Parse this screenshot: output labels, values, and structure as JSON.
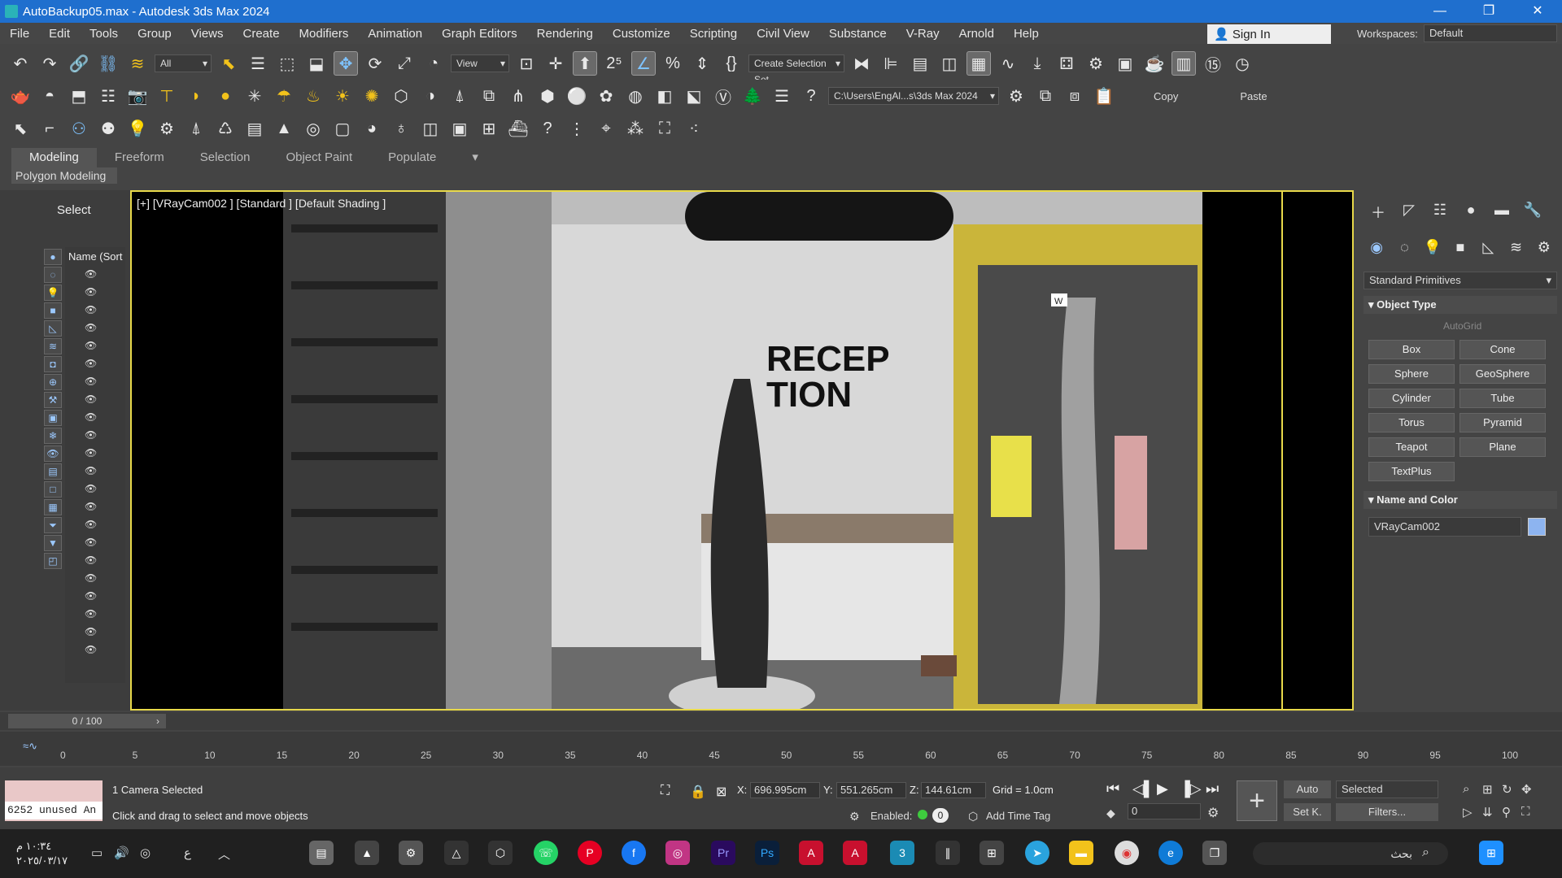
{
  "window": {
    "title": "AutoBackup05.max - Autodesk 3ds Max 2024"
  },
  "menu": [
    "File",
    "Edit",
    "Tools",
    "Group",
    "Views",
    "Create",
    "Modifiers",
    "Animation",
    "Graph Editors",
    "Rendering",
    "Customize",
    "Scripting",
    "Civil View",
    "Substance",
    "V-Ray",
    "Arnold",
    "Help"
  ],
  "signin": "Sign In",
  "workspaces": {
    "label": "Workspaces:",
    "value": "Default"
  },
  "toolbar": {
    "filter": "All",
    "view": "View",
    "selection_set": "Create Selection Set",
    "path": "C:\\Users\\EngAl...s\\3ds Max 2024",
    "copy": "Copy",
    "paste": "Paste"
  },
  "ribbon": {
    "tabs": [
      "Modeling",
      "Freeform",
      "Selection",
      "Object Paint",
      "Populate"
    ],
    "sub": "Polygon Modeling"
  },
  "scene_explorer": {
    "select_label": "Select",
    "column": "Name (Sort"
  },
  "viewport": {
    "label": "[+] [VRayCam002 ] [Standard ] [Default Shading ]",
    "sign_text_1": "RECEP",
    "sign_text_2": "TION",
    "marker": "W"
  },
  "command_panel": {
    "dropdown": "Standard Primitives",
    "object_type": "Object Type",
    "autogrid": "AutoGrid",
    "buttons": [
      "Box",
      "Cone",
      "Sphere",
      "GeoSphere",
      "Cylinder",
      "Tube",
      "Torus",
      "Pyramid",
      "Teapot",
      "Plane",
      "TextPlus"
    ],
    "name_and_color": "Name and Color",
    "object_name": "VRayCam002",
    "object_color": "#8db4f0"
  },
  "timeline": {
    "frame": "0 / 100",
    "ticks": [
      "0",
      "5",
      "10",
      "15",
      "20",
      "25",
      "30",
      "35",
      "40",
      "45",
      "50",
      "55",
      "60",
      "65",
      "70",
      "75",
      "80",
      "85",
      "90",
      "95",
      "100"
    ]
  },
  "status": {
    "maxscript": "6252  unused  An",
    "selection": "1 Camera Selected",
    "prompt": "Click and drag to select and move objects",
    "x_label": "X:",
    "x": "696.995cm",
    "y_label": "Y:",
    "y": "551.265cm",
    "z_label": "Z:",
    "z": "144.61cm",
    "grid": "Grid = 1.0cm",
    "enabled": "Enabled:",
    "enabled_value": "0",
    "add_time_tag": "Add Time Tag",
    "auto": "Auto",
    "setk": "Set K.",
    "selected": "Selected",
    "filters": "Filters...",
    "current_frame": "0"
  },
  "taskbar": {
    "time": "١٠:٣٤ م",
    "date": "٢٠٢٥/٠٣/١٧",
    "lang": "ع",
    "search": "بحث"
  }
}
